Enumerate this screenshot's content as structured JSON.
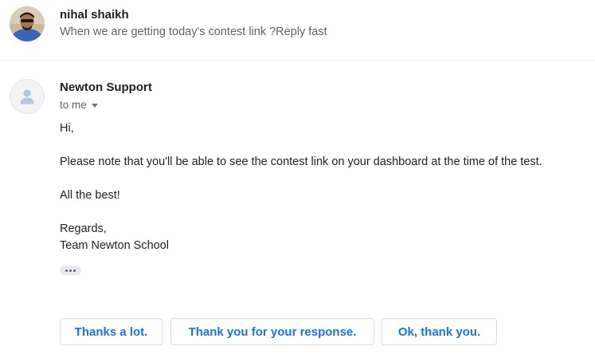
{
  "previous_message": {
    "sender": "nihal shaikh",
    "snippet": "When we are getting today's contest link ?Reply fast"
  },
  "current_message": {
    "sender": "Newton Support",
    "recipient_label": "to me",
    "body": {
      "greeting": "Hi,",
      "paragraph": "Please note that you'll be able to see the contest link on your dashboard at the time of the test.",
      "wish": "All the best!",
      "signoff": "Regards,",
      "signature": "Team Newton School"
    }
  },
  "smart_replies": [
    "Thanks a lot.",
    "Thank you for your response.",
    "Ok, thank you."
  ],
  "colors": {
    "reply_text": "#1a73e8",
    "secondary_text": "#5f6368",
    "border": "#dadce0"
  },
  "icons": {
    "sender_avatar": "user-photo",
    "support_avatar": "person-icon",
    "details_caret": "caret-down-icon",
    "show_trimmed": "ellipsis-icon"
  }
}
